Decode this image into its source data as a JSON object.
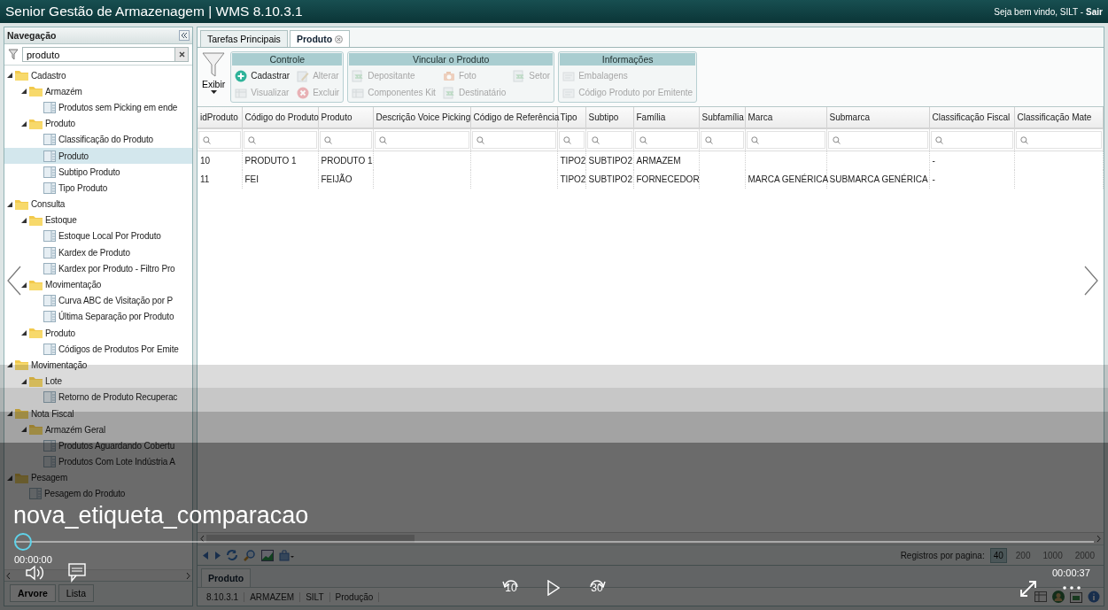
{
  "window": {
    "title": "Senior Gestão de Armazenagem | WMS 8.10.3.1",
    "greeting": "Seja bem vindo, SILT -",
    "logout": "Sair"
  },
  "navigation": {
    "title": "Navegação",
    "search": {
      "value": "produto"
    },
    "tree": [
      {
        "label": "Cadastro",
        "kind": "folder",
        "expanded": true,
        "selected": false,
        "children": [
          {
            "label": "Armazém",
            "kind": "folder",
            "expanded": true,
            "selected": false,
            "children": [
              {
                "label": "Produtos sem Picking em ende",
                "kind": "item",
                "selected": false
              }
            ]
          },
          {
            "label": "Produto",
            "kind": "folder",
            "expanded": true,
            "selected": false,
            "children": [
              {
                "label": "Classificação do Produto",
                "kind": "item",
                "selected": false
              },
              {
                "label": "Produto",
                "kind": "item",
                "selected": true
              },
              {
                "label": "Subtipo Produto",
                "kind": "item",
                "selected": false
              },
              {
                "label": "Tipo Produto",
                "kind": "item",
                "selected": false
              }
            ]
          }
        ]
      },
      {
        "label": "Consulta",
        "kind": "folder",
        "expanded": true,
        "selected": false,
        "children": [
          {
            "label": "Estoque",
            "kind": "folder",
            "expanded": true,
            "selected": false,
            "children": [
              {
                "label": "Estoque Local Por Produto",
                "kind": "item",
                "selected": false
              },
              {
                "label": "Kardex de Produto",
                "kind": "item",
                "selected": false
              },
              {
                "label": "Kardex por Produto - Filtro Pro",
                "kind": "item",
                "selected": false
              }
            ]
          },
          {
            "label": "Movimentação",
            "kind": "folder",
            "expanded": true,
            "selected": false,
            "children": [
              {
                "label": "Curva ABC de Visitação por P",
                "kind": "item",
                "selected": false
              },
              {
                "label": "Última Separação por Produto",
                "kind": "item",
                "selected": false
              }
            ]
          },
          {
            "label": "Produto",
            "kind": "folder",
            "expanded": true,
            "selected": false,
            "children": [
              {
                "label": "Códigos de Produtos Por Emite",
                "kind": "item",
                "selected": false
              }
            ]
          }
        ]
      },
      {
        "label": "Movimentação",
        "kind": "folder",
        "expanded": true,
        "selected": false,
        "children": [
          {
            "label": "Lote",
            "kind": "folder",
            "expanded": true,
            "selected": false,
            "children": [
              {
                "label": "Retorno de Produto Recuperac",
                "kind": "item",
                "selected": false
              }
            ]
          }
        ]
      },
      {
        "label": "Nota Fiscal",
        "kind": "folder",
        "expanded": true,
        "selected": false,
        "children": [
          {
            "label": "Armazém Geral",
            "kind": "folder",
            "expanded": true,
            "selected": false,
            "children": [
              {
                "label": "Produtos Aguardando Cobertu",
                "kind": "item",
                "selected": false
              },
              {
                "label": "Produtos Com Lote Indústria A",
                "kind": "item",
                "selected": false
              }
            ]
          }
        ]
      },
      {
        "label": "Pesagem",
        "kind": "folder",
        "expanded": true,
        "selected": false,
        "children": [
          {
            "label": "Pesagem do Produto",
            "kind": "item",
            "selected": false
          }
        ]
      }
    ],
    "bottom_tabs": [
      {
        "label": "Arvore",
        "selected": true
      },
      {
        "label": "Lista",
        "selected": false
      }
    ]
  },
  "main_tabs": [
    {
      "label": "Tarefas Principais",
      "selected": false,
      "closable": false
    },
    {
      "label": "Produto",
      "selected": true,
      "closable": true
    }
  ],
  "toolbar": {
    "view_button": "Exibir",
    "groups": [
      {
        "title": "Controle",
        "buttons": [
          {
            "label": "Cadastrar",
            "kind": "add",
            "disabled": false
          },
          {
            "label": "Visualizar",
            "kind": "view",
            "disabled": true
          },
          {
            "label": "Alterar",
            "kind": "edit",
            "disabled": true
          },
          {
            "label": "Excluir",
            "kind": "delete",
            "disabled": true
          }
        ]
      },
      {
        "title": "Vincular o Produto",
        "buttons": [
          {
            "label": "Depositante",
            "kind": "link",
            "disabled": true
          },
          {
            "label": "Componentes Kit",
            "kind": "view",
            "disabled": true
          },
          {
            "label": "Foto",
            "kind": "photo",
            "disabled": true
          },
          {
            "label": "Destinatário",
            "kind": "link",
            "disabled": true
          },
          {
            "label": "Setor",
            "kind": "link",
            "disabled": true
          }
        ]
      },
      {
        "title": "Informações",
        "buttons": [
          {
            "label": "Embalagens",
            "kind": "list",
            "disabled": true
          },
          {
            "label": "Código Produto por Emitente",
            "kind": "list",
            "disabled": true
          }
        ]
      }
    ]
  },
  "table": {
    "columns": [
      "idProduto",
      "Código do Produto",
      "Produto",
      "Descrição Voice Picking",
      "Código de Referência",
      "Tipo",
      "Subtipo",
      "Família",
      "Subfamília",
      "Marca",
      "Submarca",
      "Classificação Fiscal",
      "Classificação Mate"
    ],
    "rows": [
      [
        "10",
        "PRODUTO 1",
        "PRODUTO 1",
        null,
        null,
        "TIPO2",
        "SUBTIPO2",
        "ARMAZEM",
        null,
        null,
        null,
        "-",
        null
      ],
      [
        "11",
        "FEI",
        "FEIJÃO",
        null,
        null,
        "TIPO2",
        "SUBTIPO2",
        "FORNECEDOR",
        null,
        "MARCA GENÉRICA",
        "SUBMARCA GENÉRICA",
        "-",
        null
      ]
    ]
  },
  "pager": {
    "label": "Registros por pagina:",
    "options": [
      {
        "label": "40",
        "selected": true
      },
      {
        "label": "200",
        "selected": false
      },
      {
        "label": "1000",
        "selected": false
      },
      {
        "label": "2000",
        "selected": false
      }
    ]
  },
  "bottom_tabs": [
    {
      "label": "Produto",
      "selected": true
    }
  ],
  "status_bar": [
    "8.10.3.1",
    "ARMAZEM",
    "SILT",
    "Produção"
  ],
  "video_player": {
    "title": "nova_etiqueta_comparacao",
    "elapsed": "00:00:00",
    "duration": "00:00:37",
    "level": 0,
    "skip_back": "10",
    "skip_forward": "30"
  }
}
